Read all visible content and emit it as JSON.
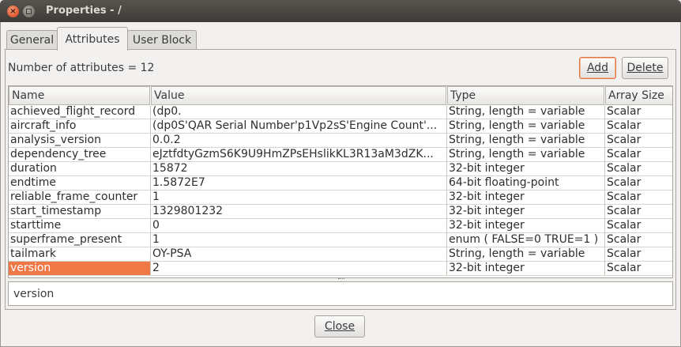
{
  "window": {
    "title": "Properties - /"
  },
  "tabs": [
    {
      "label": "General"
    },
    {
      "label": "Attributes"
    },
    {
      "label": "User Block"
    }
  ],
  "attributes": {
    "count_label": "Number of attributes = 12",
    "add_label": "Add",
    "delete_label": "Delete",
    "columns": [
      "Name",
      "Value",
      "Type",
      "Array Size"
    ],
    "rows": [
      {
        "name": "achieved_flight_record",
        "value": "(dp0.",
        "type": "String, length = variable",
        "size": "Scalar"
      },
      {
        "name": "aircraft_info",
        "value": "(dp0S'QAR Serial Number'p1Vp2sS'Engine Count'...",
        "type": "String, length = variable",
        "size": "Scalar"
      },
      {
        "name": "analysis_version",
        "value": "0.0.2",
        "type": "String, length = variable",
        "size": "Scalar"
      },
      {
        "name": "dependency_tree",
        "value": "eJztfdtyGzmS6K9U9HmZPsEHslikKL3R13aM3dZK...",
        "type": "String, length = variable",
        "size": "Scalar"
      },
      {
        "name": "duration",
        "value": "15872",
        "type": "32-bit integer",
        "size": "Scalar"
      },
      {
        "name": "endtime",
        "value": "1.5872E7",
        "type": "64-bit floating-point",
        "size": "Scalar"
      },
      {
        "name": "reliable_frame_counter",
        "value": "1",
        "type": "32-bit integer",
        "size": "Scalar"
      },
      {
        "name": "start_timestamp",
        "value": "1329801232",
        "type": "32-bit integer",
        "size": "Scalar"
      },
      {
        "name": "starttime",
        "value": "0",
        "type": "32-bit integer",
        "size": "Scalar"
      },
      {
        "name": "superframe_present",
        "value": "1",
        "type": "enum ( FALSE=0  TRUE=1  )",
        "size": "Scalar"
      },
      {
        "name": "tailmark",
        "value": "OY-PSA",
        "type": "String, length = variable",
        "size": "Scalar"
      },
      {
        "name": "version",
        "value": "2",
        "type": "32-bit integer",
        "size": "Scalar"
      }
    ],
    "selected_detail": "version"
  },
  "footer": {
    "close_label": "Close"
  }
}
